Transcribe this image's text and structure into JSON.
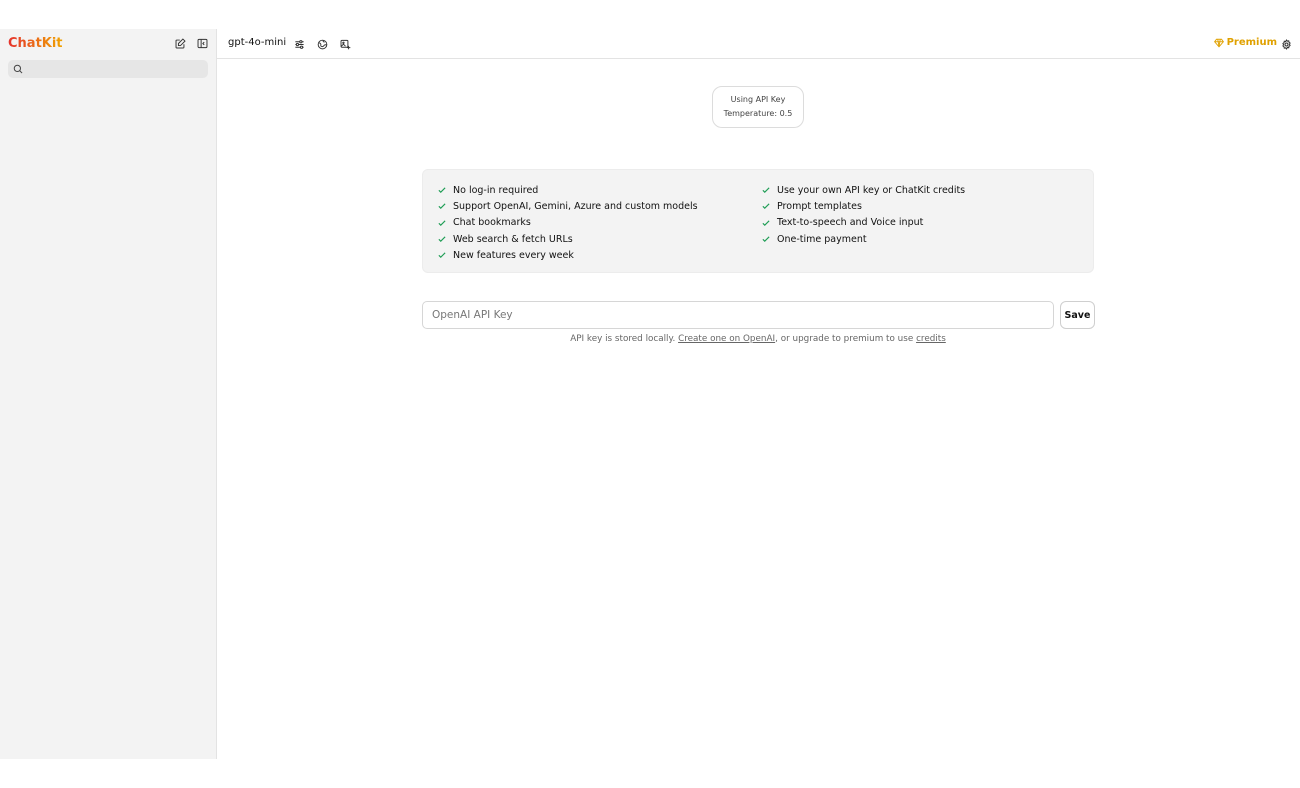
{
  "sidebar": {
    "brand": "ChatKit",
    "search": {
      "placeholder": "",
      "value": ""
    },
    "icons": [
      "new-chat-icon",
      "toggle-sidebar-icon"
    ]
  },
  "topbar": {
    "model": "gpt-4o-mini",
    "icons": [
      "sliders-icon",
      "globe-icon",
      "image-plus-icon"
    ],
    "premium_label": "Premium",
    "settings_icon": "gear-icon"
  },
  "badge": {
    "line1": "Using API Key",
    "line2": "Temperature: 0.5"
  },
  "features": {
    "left": [
      "No log-in required",
      "Support OpenAI, Gemini, Azure and custom models",
      "Chat bookmarks",
      "Web search & fetch URLs",
      "New features every week"
    ],
    "right": [
      "Use your own API key or ChatKit credits",
      "Prompt templates",
      "Text-to-speech and Voice input",
      "One-time payment"
    ]
  },
  "api": {
    "placeholder": "OpenAI API Key",
    "value": "",
    "save_label": "Save",
    "note_prefix": "API key is stored locally. ",
    "note_link1": "Create one on OpenAI",
    "note_middle": ", or upgrade to premium to use ",
    "note_link2": "credits"
  },
  "colors": {
    "brand_start": "#e5322d",
    "brand_end": "#f0a400",
    "premium": "#e0a100",
    "check": "#1f9d55",
    "sidebar_bg": "#f3f3f3"
  }
}
